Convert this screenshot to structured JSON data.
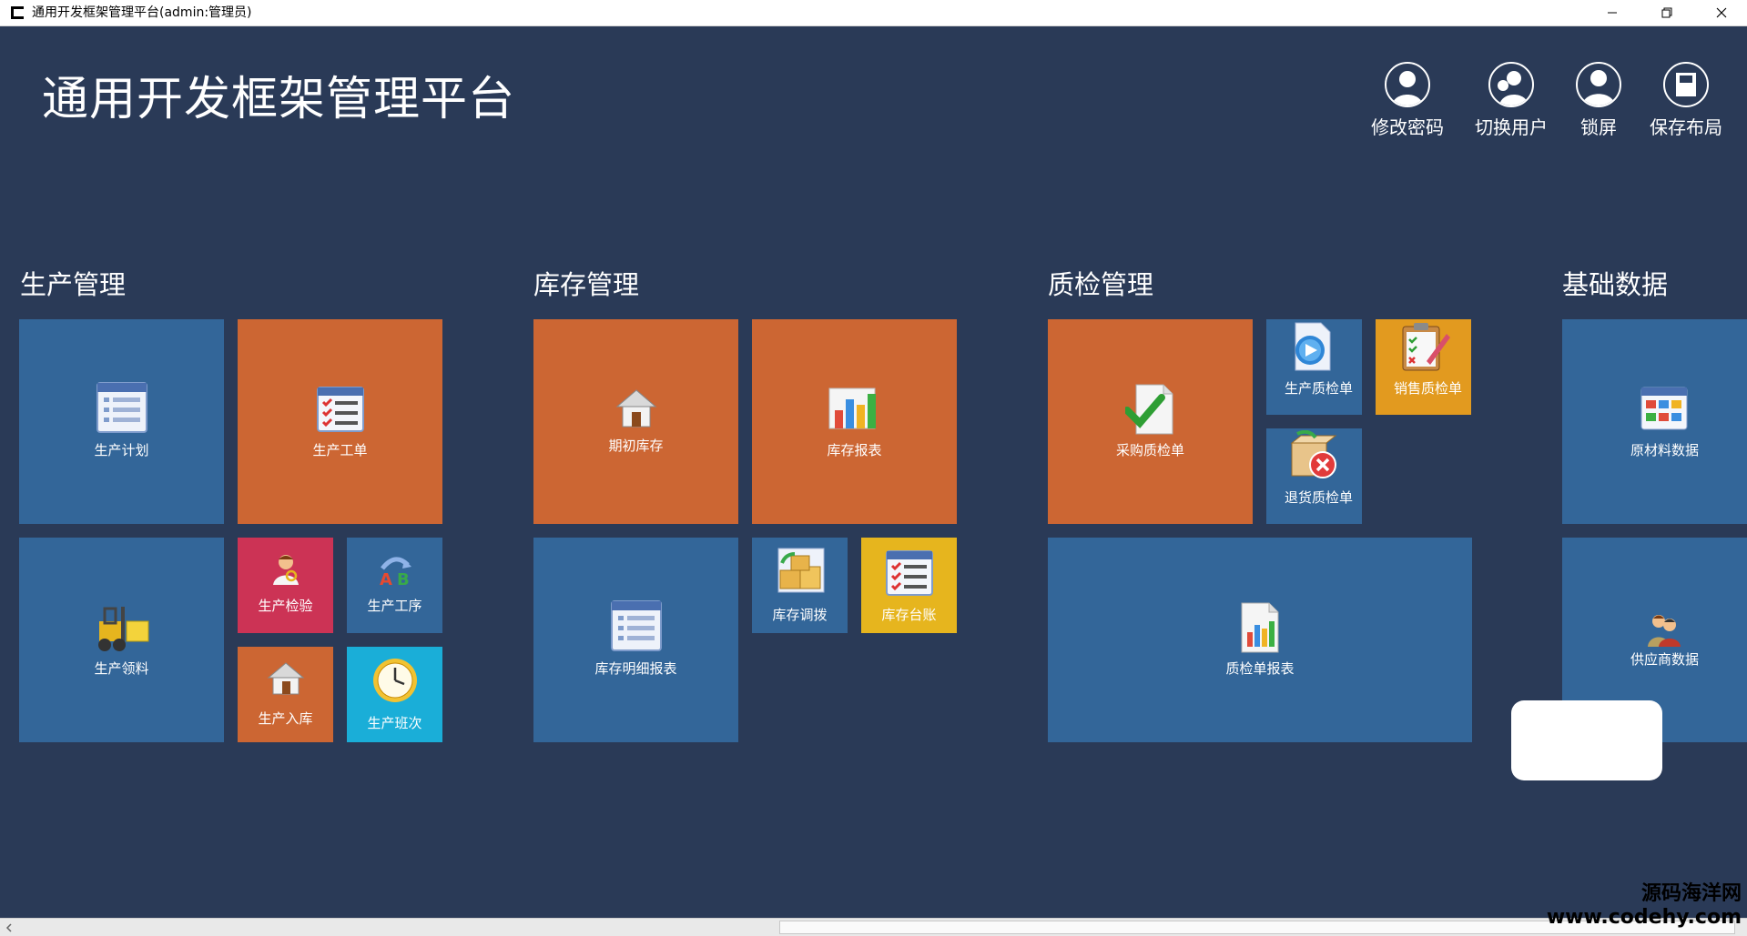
{
  "window": {
    "title": "通用开发框架管理平台(admin:管理员)"
  },
  "header": {
    "app_title": "通用开发框架管理平台",
    "actions": [
      {
        "label": "修改密码",
        "icon": "user-key-icon"
      },
      {
        "label": "切换用户",
        "icon": "switch-user-icon"
      },
      {
        "label": "锁屏",
        "icon": "lock-screen-icon"
      },
      {
        "label": "保存布局",
        "icon": "save-layout-icon"
      }
    ]
  },
  "groups": {
    "production": {
      "title": "生产管理",
      "tiles": {
        "plan": "生产计划",
        "work_order": "生产工单",
        "material_pick": "生产领料",
        "inspection": "生产检验",
        "process": "生产工序",
        "warehousing": "生产入库",
        "shift": "生产班次"
      }
    },
    "inventory": {
      "title": "库存管理",
      "tiles": {
        "opening": "期初库存",
        "report": "库存报表",
        "detail_report": "库存明细报表",
        "transfer": "库存调拨",
        "ledger": "库存台账"
      }
    },
    "quality": {
      "title": "质检管理",
      "tiles": {
        "purchase_qc": "采购质检单",
        "production_qc": "生产质检单",
        "sales_qc": "销售质检单",
        "return_qc": "退货质检单",
        "qc_report": "质检单报表"
      }
    },
    "basic": {
      "title": "基础数据",
      "tiles": {
        "raw_material": "原材料数据",
        "supplier": "供应商数据"
      }
    }
  },
  "watermark": {
    "line1": "源码海洋网",
    "line2": "www.codehy.com"
  },
  "colors": {
    "background": "#2a3a57",
    "tile_blue": "#336699",
    "tile_orange": "#cc6633",
    "tile_red": "#cc3355",
    "tile_cyan": "#1aaed8",
    "tile_gold": "#e6b51e",
    "tile_amber": "#e29a1f"
  }
}
